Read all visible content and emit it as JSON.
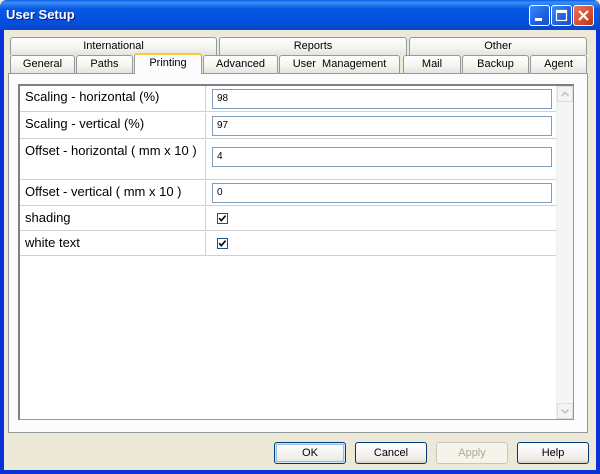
{
  "window": {
    "title": "User Setup"
  },
  "tabs_top": [
    "International",
    "Reports",
    "Other"
  ],
  "tabs_bottom": [
    "General",
    "Paths",
    "Printing",
    "Advanced",
    "User  Management",
    "Mail",
    "Backup",
    "Agent"
  ],
  "active_tab": "Printing",
  "settings": {
    "scaling_horizontal": {
      "label": "Scaling - horizontal (%)",
      "value": "98"
    },
    "scaling_vertical": {
      "label": "Scaling - vertical (%)",
      "value": "97"
    },
    "offset_horizontal": {
      "label": "Offset - horizontal ( mm x 10 )",
      "value": "4"
    },
    "offset_vertical": {
      "label": "Offset - vertical ( mm x 10 )",
      "value": "0"
    },
    "shading": {
      "label": "shading",
      "checked": true
    },
    "white_text": {
      "label": "white text",
      "checked": true
    }
  },
  "buttons": {
    "ok": "OK",
    "cancel": "Cancel",
    "apply": "Apply",
    "help": "Help"
  },
  "colors": {
    "title_bar": "#0558E4",
    "active_tab_accent": "#FFC83C",
    "background": "#ECE9D8"
  }
}
